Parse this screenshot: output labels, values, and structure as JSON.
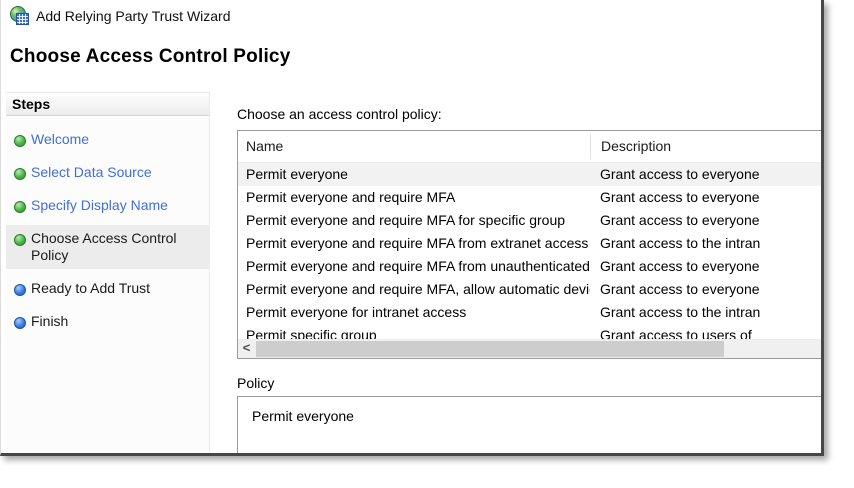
{
  "window": {
    "title": "Add Relying Party Trust Wizard",
    "icon": "adfs-trust-icon"
  },
  "page": {
    "heading": "Choose Access Control Policy"
  },
  "sidebar": {
    "header": "Steps",
    "steps": [
      {
        "label": "Welcome",
        "state": "completed"
      },
      {
        "label": "Select Data Source",
        "state": "completed"
      },
      {
        "label": "Specify Display Name",
        "state": "completed"
      },
      {
        "label": "Choose Access Control Policy",
        "state": "current"
      },
      {
        "label": "Ready to Add Trust",
        "state": "upcoming"
      },
      {
        "label": "Finish",
        "state": "upcoming"
      }
    ],
    "colors": {
      "completed_bullet": "#3aa73a",
      "upcoming_bullet": "#2f78e0",
      "link_text": "#3f6fd8",
      "current_step_bg": "#ececec"
    }
  },
  "main": {
    "table_label": "Choose an access control policy:",
    "table": {
      "columns": [
        "Name",
        "Description"
      ],
      "rows": [
        {
          "name": "Permit everyone",
          "description": "Grant access to everyone",
          "selected": true
        },
        {
          "name": "Permit everyone and require MFA",
          "description": "Grant access to everyone",
          "selected": false
        },
        {
          "name": "Permit everyone and require MFA for specific group",
          "description": "Grant access to everyone",
          "selected": false
        },
        {
          "name": "Permit everyone and require MFA from extranet access",
          "description": "Grant access to the intran",
          "selected": false
        },
        {
          "name": "Permit everyone and require MFA from unauthenticated devices",
          "description": "Grant access to everyone",
          "selected": false
        },
        {
          "name": "Permit everyone and require MFA, allow automatic device registr...",
          "description": "Grant access to everyone",
          "selected": false
        },
        {
          "name": "Permit everyone for intranet access",
          "description": "Grant access to the intran",
          "selected": false
        },
        {
          "name": "Permit specific group",
          "description": "Grant access to users of",
          "selected": false
        }
      ],
      "selected_row_bg": "#f2f2f2"
    },
    "scrollbar": {
      "left_arrow": "<"
    },
    "policy_label": "Policy",
    "policy_value": "Permit everyone"
  }
}
